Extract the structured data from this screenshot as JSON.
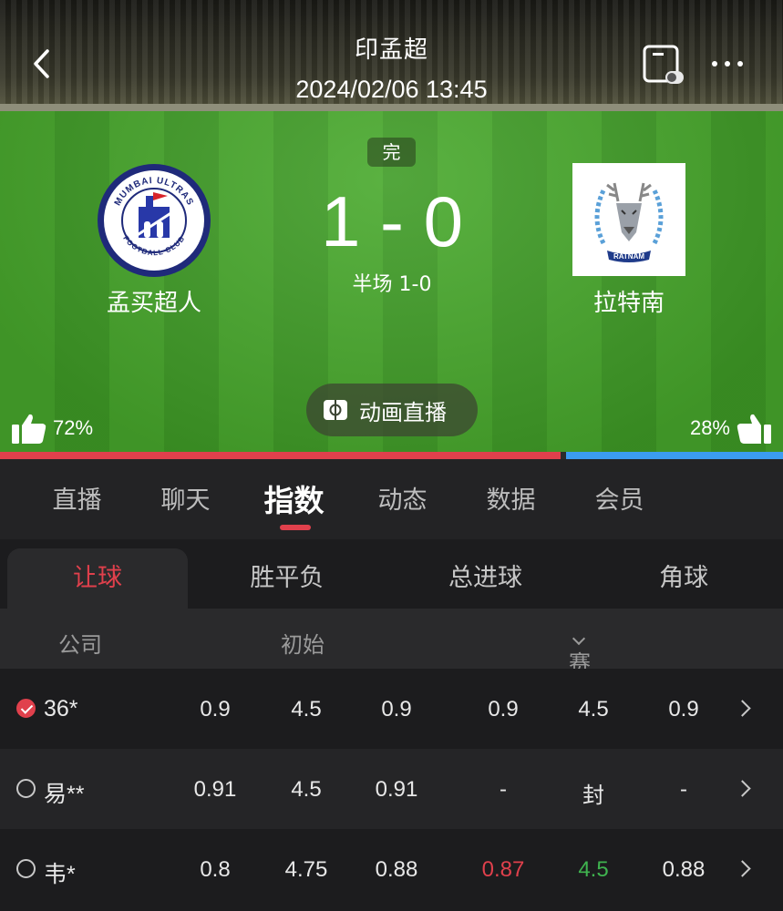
{
  "header": {
    "league": "印孟超",
    "datetime": "2024/02/06 13:45"
  },
  "match": {
    "status": "完",
    "score": "1 - 0",
    "halftime": "半场 1-0",
    "home": {
      "name": "孟买超人",
      "logo_text_top": "MUMBAI ULTRAS",
      "logo_text_bottom": "FOOTBALL CLUB",
      "vote": "72%",
      "vote_fraction": 0.72
    },
    "away": {
      "name": "拉特南",
      "logo_text": "RATNAM",
      "vote": "28%",
      "vote_fraction": 0.28
    },
    "animation_label": "动画直播"
  },
  "tabs": {
    "main": [
      {
        "label": "直播"
      },
      {
        "label": "聊天"
      },
      {
        "label": "指数",
        "active": true
      },
      {
        "label": "动态"
      },
      {
        "label": "数据"
      },
      {
        "label": "会员"
      }
    ],
    "sub": [
      {
        "label": "让球",
        "active": true
      },
      {
        "label": "胜平负"
      },
      {
        "label": "总进球"
      },
      {
        "label": "角球"
      }
    ]
  },
  "odds_table": {
    "headers": {
      "company": "公司",
      "initial": "初始",
      "pre": "赛前"
    },
    "rows": [
      {
        "company": "36*",
        "checked": true,
        "initial": [
          "0.9",
          "4.5",
          "0.9"
        ],
        "pre": [
          "0.9",
          "4.5",
          "0.9"
        ]
      },
      {
        "company": "易**",
        "checked": false,
        "initial": [
          "0.91",
          "4.5",
          "0.91"
        ],
        "pre": [
          "-",
          "封",
          "-"
        ]
      },
      {
        "company": "韦*",
        "checked": false,
        "initial": [
          "0.8",
          "4.75",
          "0.88"
        ],
        "pre": [
          "0.87",
          "4.5",
          "0.88"
        ],
        "pre_colors": [
          "red",
          "green",
          ""
        ]
      }
    ]
  },
  "colors": {
    "accent": "#e0404c",
    "home_bar": "#e0404c",
    "away_bar": "#3b9cf0",
    "down": "#e0404c",
    "up": "#3fb34f"
  }
}
